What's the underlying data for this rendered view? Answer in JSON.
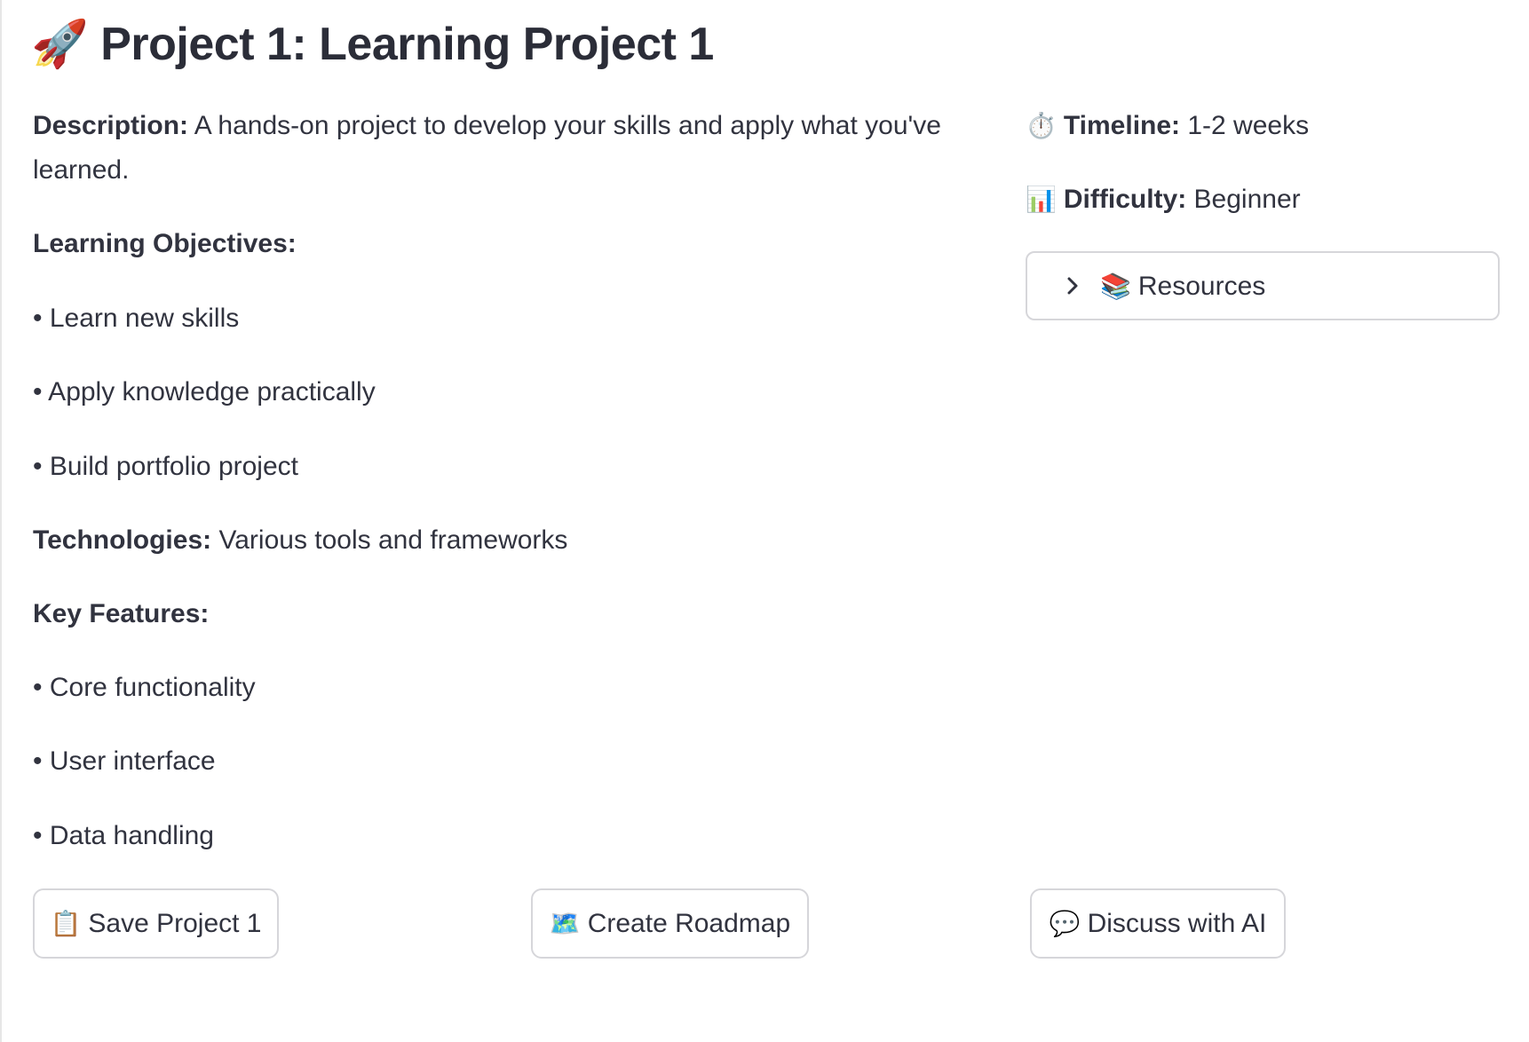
{
  "header": {
    "emoji": "🚀",
    "title": "Project 1: Learning Project 1"
  },
  "details": {
    "description_label": "Description:",
    "description_text": " A hands-on project to develop your skills and apply what you've learned.",
    "objectives_label": "Learning Objectives:",
    "objectives": [
      "• Learn new skills",
      "• Apply knowledge practically",
      "• Build portfolio project"
    ],
    "technologies_label": "Technologies:",
    "technologies_text": " Various tools and frameworks",
    "features_label": "Key Features:",
    "features": [
      "• Core functionality",
      "• User interface",
      "• Data handling"
    ]
  },
  "sidebar": {
    "timeline_emoji": "⏱️",
    "timeline_label": "Timeline:",
    "timeline_value": " 1-2 weeks",
    "difficulty_emoji": "📊",
    "difficulty_label": "Difficulty:",
    "difficulty_value": " Beginner",
    "resources_emoji": "📚",
    "resources_label": "Resources"
  },
  "actions": {
    "save_emoji": "📋",
    "save_label": "Save Project 1",
    "roadmap_emoji": "🗺️",
    "roadmap_label": "Create Roadmap",
    "discuss_emoji": "💬",
    "discuss_label": "Discuss with AI"
  }
}
